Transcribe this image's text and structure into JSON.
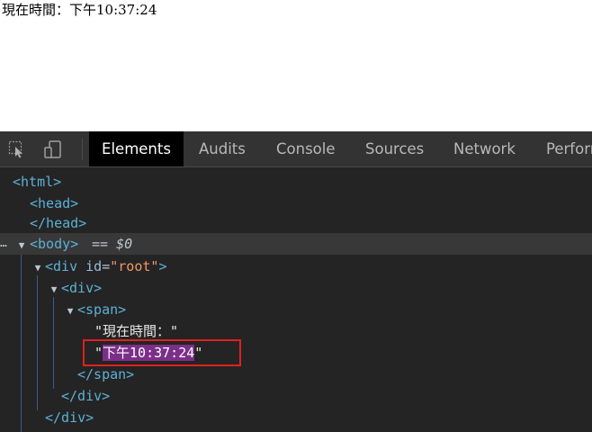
{
  "page": {
    "text": "現在時間：下午10:37:24"
  },
  "devtools": {
    "toolbar": {
      "icons": [
        "inspect-element-icon",
        "device-toolbar-icon"
      ],
      "tabs": [
        {
          "label": "Elements",
          "active": true
        },
        {
          "label": "Audits",
          "active": false
        },
        {
          "label": "Console",
          "active": false
        },
        {
          "label": "Sources",
          "active": false
        },
        {
          "label": "Network",
          "active": false
        },
        {
          "label": "Perform",
          "active": false
        }
      ]
    },
    "tree": {
      "html_open": "<html>",
      "head_open": "<head>",
      "head_close": "</head>",
      "body_open": "<body>",
      "body_suffix": "== $0",
      "div_root_tag": "<div ",
      "div_root_attr_name": "id",
      "div_root_attr_eq": "=",
      "div_root_attr_value": "\"root\"",
      "div_root_tag_end": ">",
      "div_open": "<div>",
      "span_open": "<span>",
      "text_node_1": "\"現在時間：\"",
      "text_node_2_quote_open": "\"",
      "text_node_2_value": "下午10:37:24",
      "text_node_2_quote_close": "\"",
      "span_close": "</span>",
      "div_close": "</div>",
      "div_root_close": "</div>"
    },
    "colors": {
      "panel_bg": "#242424",
      "toolbar_bg": "#333333",
      "active_tab_bg": "#000000",
      "tag": "#5db0d7",
      "attr_value": "#f29766",
      "search_highlight": "#7b2f89",
      "annotation_box": "#e02020"
    }
  }
}
